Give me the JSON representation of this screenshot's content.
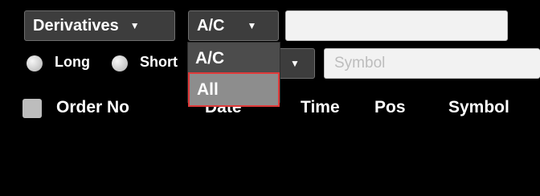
{
  "filters": {
    "segment": {
      "value": "Derivatives",
      "caret": "▼"
    },
    "account": {
      "value": "A/C",
      "caret": "▼"
    },
    "text_input": {
      "value": ""
    },
    "position": {
      "long_label": "Long",
      "short_label": "Short"
    },
    "hidden_select": {
      "caret": "▼"
    },
    "symbol": {
      "placeholder": "Symbol"
    }
  },
  "account_dropdown": {
    "options": [
      {
        "label": "A/C"
      },
      {
        "label": "All"
      }
    ]
  },
  "table": {
    "columns": [
      "Order No",
      "Date",
      "Time",
      "Pos",
      "Symbol"
    ]
  }
}
